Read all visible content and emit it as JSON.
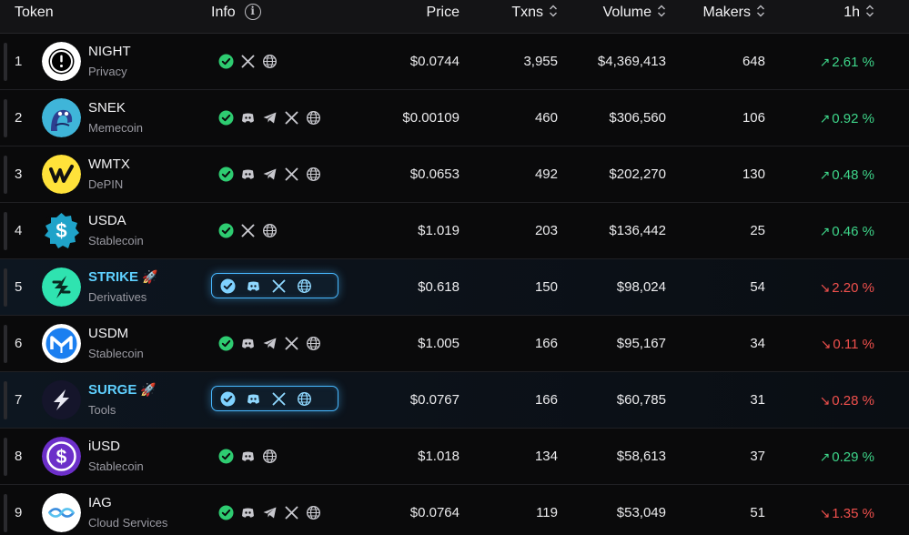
{
  "header": {
    "token": "Token",
    "info": "Info",
    "info_icon": "i",
    "price": "Price",
    "txns": "Txns",
    "volume": "Volume",
    "makers": "Makers",
    "change": "1h"
  },
  "colors": {
    "up": "#3ed68a",
    "down": "#f0504d",
    "promo_accent": "#48b8ff"
  },
  "rows": [
    {
      "rank": "1",
      "name": "NIGHT",
      "category": "Privacy",
      "logo": "night-logo",
      "links": [
        "verified",
        "x",
        "web"
      ],
      "price": "$0.0744",
      "txns": "3,955",
      "volume": "$4,369,413",
      "makers": "648",
      "change": "2.61 %",
      "dir": "up",
      "promoted": false
    },
    {
      "rank": "2",
      "name": "SNEK",
      "category": "Memecoin",
      "logo": "snek-logo",
      "links": [
        "verified",
        "discord",
        "telegram",
        "x",
        "web"
      ],
      "price": "$0.00109",
      "txns": "460",
      "volume": "$306,560",
      "makers": "106",
      "change": "0.92 %",
      "dir": "up",
      "promoted": false
    },
    {
      "rank": "3",
      "name": "WMTX",
      "category": "DePIN",
      "logo": "wmtx-logo",
      "links": [
        "verified",
        "discord",
        "telegram",
        "x",
        "web"
      ],
      "price": "$0.0653",
      "txns": "492",
      "volume": "$202,270",
      "makers": "130",
      "change": "0.48 %",
      "dir": "up",
      "promoted": false
    },
    {
      "rank": "4",
      "name": "USDA",
      "category": "Stablecoin",
      "logo": "usda-logo",
      "links": [
        "verified",
        "x",
        "web"
      ],
      "price": "$1.019",
      "txns": "203",
      "volume": "$136,442",
      "makers": "25",
      "change": "0.46 %",
      "dir": "up",
      "promoted": false
    },
    {
      "rank": "5",
      "name": "STRIKE",
      "category": "Derivatives",
      "logo": "strike-logo",
      "links": [
        "verified",
        "discord",
        "x",
        "web"
      ],
      "price": "$0.618",
      "txns": "150",
      "volume": "$98,024",
      "makers": "54",
      "change": "2.20 %",
      "dir": "down",
      "promoted": true
    },
    {
      "rank": "6",
      "name": "USDM",
      "category": "Stablecoin",
      "logo": "usdm-logo",
      "links": [
        "verified",
        "discord",
        "telegram",
        "x",
        "web"
      ],
      "price": "$1.005",
      "txns": "166",
      "volume": "$95,167",
      "makers": "34",
      "change": "0.11 %",
      "dir": "down",
      "promoted": false
    },
    {
      "rank": "7",
      "name": "SURGE",
      "category": "Tools",
      "logo": "surge-logo",
      "links": [
        "verified",
        "discord",
        "x",
        "web"
      ],
      "price": "$0.0767",
      "txns": "166",
      "volume": "$60,785",
      "makers": "31",
      "change": "0.28 %",
      "dir": "down",
      "promoted": true
    },
    {
      "rank": "8",
      "name": "iUSD",
      "category": "Stablecoin",
      "logo": "iusd-logo",
      "links": [
        "verified",
        "discord",
        "web"
      ],
      "price": "$1.018",
      "txns": "134",
      "volume": "$58,613",
      "makers": "37",
      "change": "0.29 %",
      "dir": "up",
      "promoted": false
    },
    {
      "rank": "9",
      "name": "IAG",
      "category": "Cloud Services",
      "logo": "iag-logo",
      "links": [
        "verified",
        "discord",
        "telegram",
        "x",
        "web"
      ],
      "price": "$0.0764",
      "txns": "119",
      "volume": "$53,049",
      "makers": "51",
      "change": "1.35 %",
      "dir": "down",
      "promoted": false
    }
  ]
}
